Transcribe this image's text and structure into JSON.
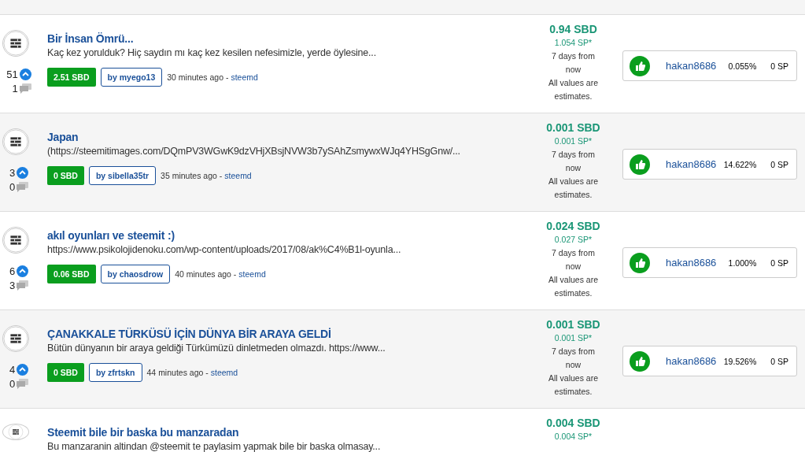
{
  "posts": [
    {
      "title": "Bir İnsan Ömrü...",
      "excerpt": "Kaç kez yorulduk? Hiç saydın mı kaç kez kesilen nefesimizle, yerde öylesine...",
      "votes": "51",
      "comments": "1",
      "payout_badge": "2.51 SBD",
      "author": "by myego13",
      "time": "30 minutes ago -",
      "source": "steemd",
      "value": "0.94 SBD",
      "sp": "1.054 SP*",
      "note_1": "7 days from",
      "note_2": "now",
      "note_3": "All values are",
      "note_4": "estimates.",
      "voter": "hakan8686",
      "percent": "0.055%",
      "voter_sp": "0 SP"
    },
    {
      "title": "Japan",
      "excerpt": "(https://steemitimages.com/DQmPV3WGwK9dzVHjXBsjNVW3b7ySAhZsmywxWJq4YHSgGnw/...",
      "votes": "3",
      "comments": "0",
      "payout_badge": "0 SBD",
      "author": "by sibella35tr",
      "time": "35 minutes ago -",
      "source": "steemd",
      "value": "0.001 SBD",
      "sp": "0.001 SP*",
      "note_1": "7 days from",
      "note_2": "now",
      "note_3": "All values are",
      "note_4": "estimates.",
      "voter": "hakan8686",
      "percent": "14.622%",
      "voter_sp": "0 SP"
    },
    {
      "title": "akıl oyunları ve steemit :)",
      "excerpt": "https://www.psikolojidenoku.com/wp-content/uploads/2017/08/ak%C4%B1l-oyunla...",
      "votes": "6",
      "comments": "3",
      "payout_badge": "0.06 SBD",
      "author": "by chaosdrow",
      "time": "40 minutes ago -",
      "source": "steemd",
      "value": "0.024 SBD",
      "sp": "0.027 SP*",
      "note_1": "7 days from",
      "note_2": "now",
      "note_3": "All values are",
      "note_4": "estimates.",
      "voter": "hakan8686",
      "percent": "1.000%",
      "voter_sp": "0 SP"
    },
    {
      "title": "ÇANAKKALE TÜRKÜSÜ İÇİN DÜNYA BİR ARAYA GELDİ",
      "excerpt": "Bütün dünyanın bir araya geldiği Türkümüzü dinletmeden olmazdı. https://www...",
      "votes": "4",
      "comments": "0",
      "payout_badge": "0 SBD",
      "author": "by zfrtskn",
      "time": "44 minutes ago -",
      "source": "steemd",
      "value": "0.001 SBD",
      "sp": "0.001 SP*",
      "note_1": "7 days from",
      "note_2": "now",
      "note_3": "All values are",
      "note_4": "estimates.",
      "voter": "hakan8686",
      "percent": "19.526%",
      "voter_sp": "0 SP"
    },
    {
      "title": "Steemit bile bir baska bu manzaradan",
      "excerpt": "Bu manzaranin altindan @steemit te paylasim yapmak bile bir baska olmasay...",
      "value": "0.004 SBD",
      "sp": "0.004 SP*"
    }
  ]
}
